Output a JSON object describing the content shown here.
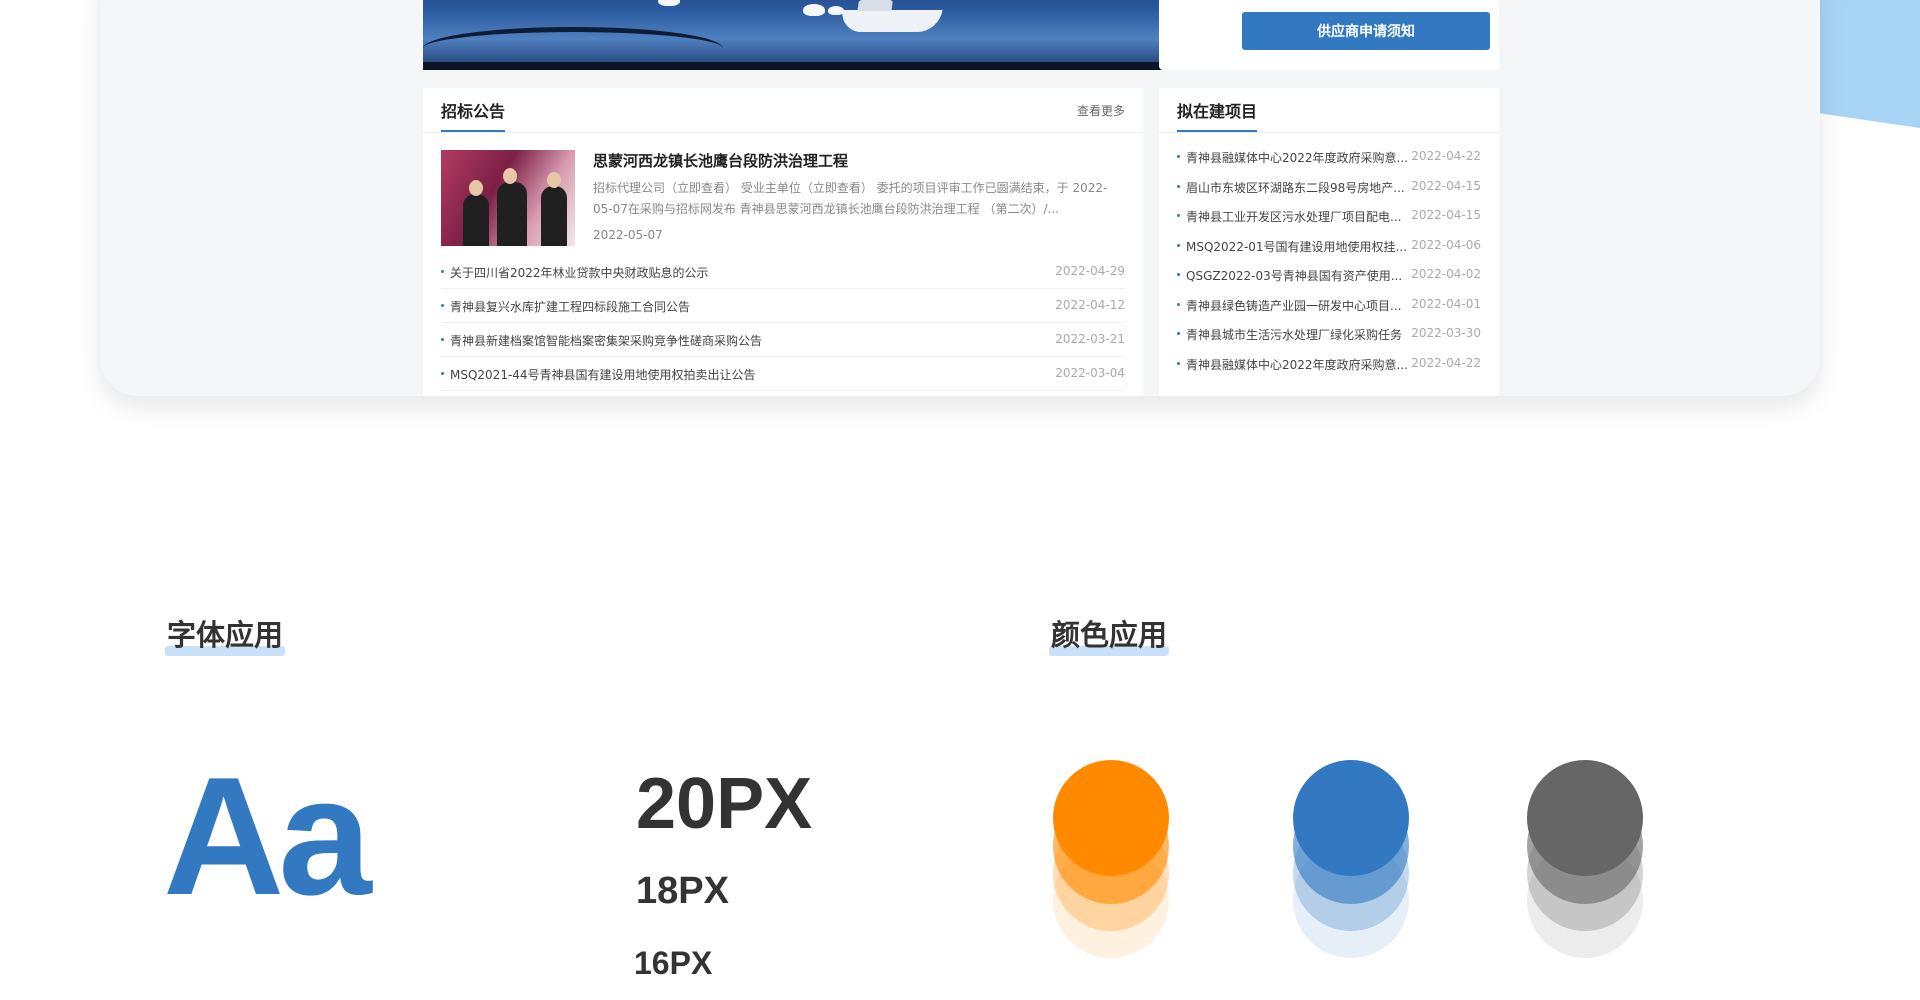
{
  "notice": {
    "supplier_button": "供应商申请须知"
  },
  "tenders": {
    "title": "招标公告",
    "more": "查看更多",
    "feature": {
      "title": "思蒙河西龙镇长池鹰台段防洪治理工程",
      "description": "招标代理公司（立即查看） 受业主单位（立即查看） 委托的项目评审工作已圆满结束，于 2022-05-07在采购与招标网发布 青神县思蒙河西龙镇长池鹰台段防洪治理工程 （第二次）/...",
      "date": "2022-05-07"
    },
    "items": [
      {
        "title": "关于四川省2022年林业贷款中央财政贴息的公示",
        "date": "2022-04-29"
      },
      {
        "title": "青神县复兴水库扩建工程四标段施工合同公告",
        "date": "2022-04-12"
      },
      {
        "title": "青神县新建档案馆智能档案密集架采购竞争性磋商采购公告",
        "date": "2022-03-21"
      },
      {
        "title": "MSQ2021-44号青神县国有建设用地使用权拍卖出让公告",
        "date": "2022-03-04"
      }
    ]
  },
  "projects": {
    "title": "拟在建项目",
    "items": [
      {
        "title": "青神县融媒体中心2022年度政府采购意...",
        "date": "2022-04-22"
      },
      {
        "title": "眉山市东坡区环湖路东二段98号房地产...",
        "date": "2022-04-15"
      },
      {
        "title": "青神县工业开发区污水处理厂项目配电...",
        "date": "2022-04-15"
      },
      {
        "title": "MSQ2022-01号国有建设用地使用权挂...",
        "date": "2022-04-06"
      },
      {
        "title": "QSGZ2022-03号青神县国有资产使用...",
        "date": "2022-04-02"
      },
      {
        "title": "青神县绿色铸造产业园一研发中心项目...",
        "date": "2022-04-01"
      },
      {
        "title": "青神县城市生活污水处理厂绿化采购任务",
        "date": "2022-03-30"
      },
      {
        "title": "青神县融媒体中心2022年度政府采购意...",
        "date": "2022-04-22"
      }
    ]
  },
  "fonts": {
    "title": "字体应用",
    "sample": "Aa",
    "sizes": [
      "20PX",
      "18PX",
      "16PX"
    ]
  },
  "colors": {
    "title": "颜色应用",
    "swatches": [
      {
        "name": "orange",
        "hex": "#ff8a00"
      },
      {
        "name": "blue",
        "hex": "#3279c2"
      },
      {
        "name": "gray",
        "hex": "#666666"
      }
    ]
  }
}
